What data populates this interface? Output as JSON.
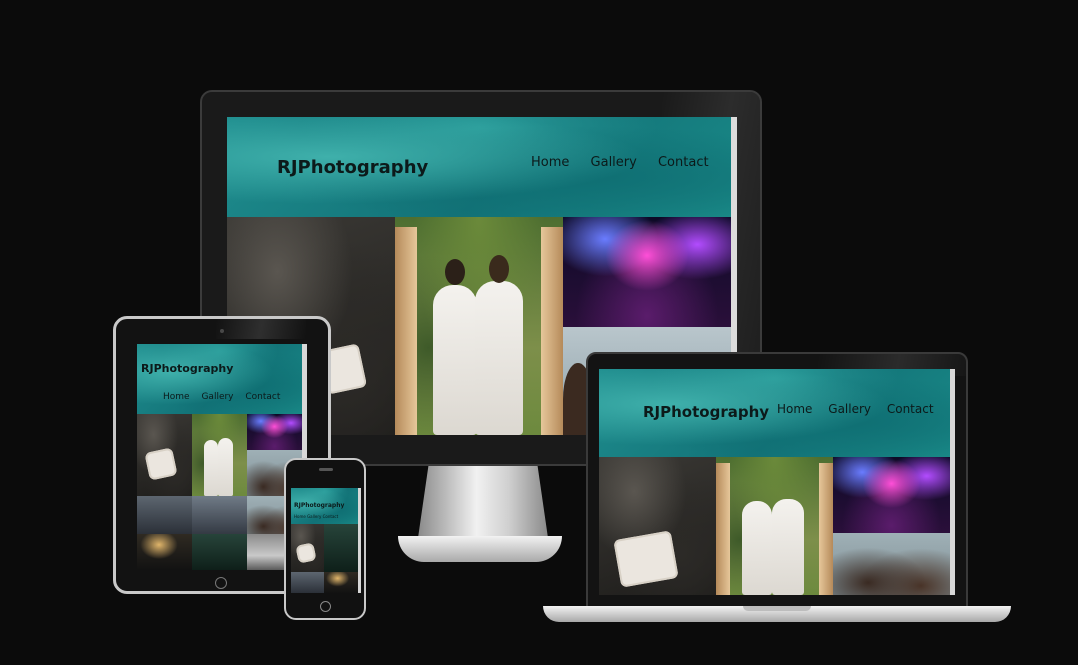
{
  "site": {
    "logo": "RJPhotography",
    "nav": [
      "Home",
      "Gallery",
      "Contact"
    ],
    "mobile_nav": "Home Gallery Contact"
  },
  "colors": {
    "background": "#0b0b0b",
    "header_teal": "#1f8d8e",
    "device_frame": "#111111",
    "device_silver": "#d9d9d9"
  },
  "devices": [
    "desktop-monitor",
    "tablet",
    "phone",
    "laptop"
  ]
}
